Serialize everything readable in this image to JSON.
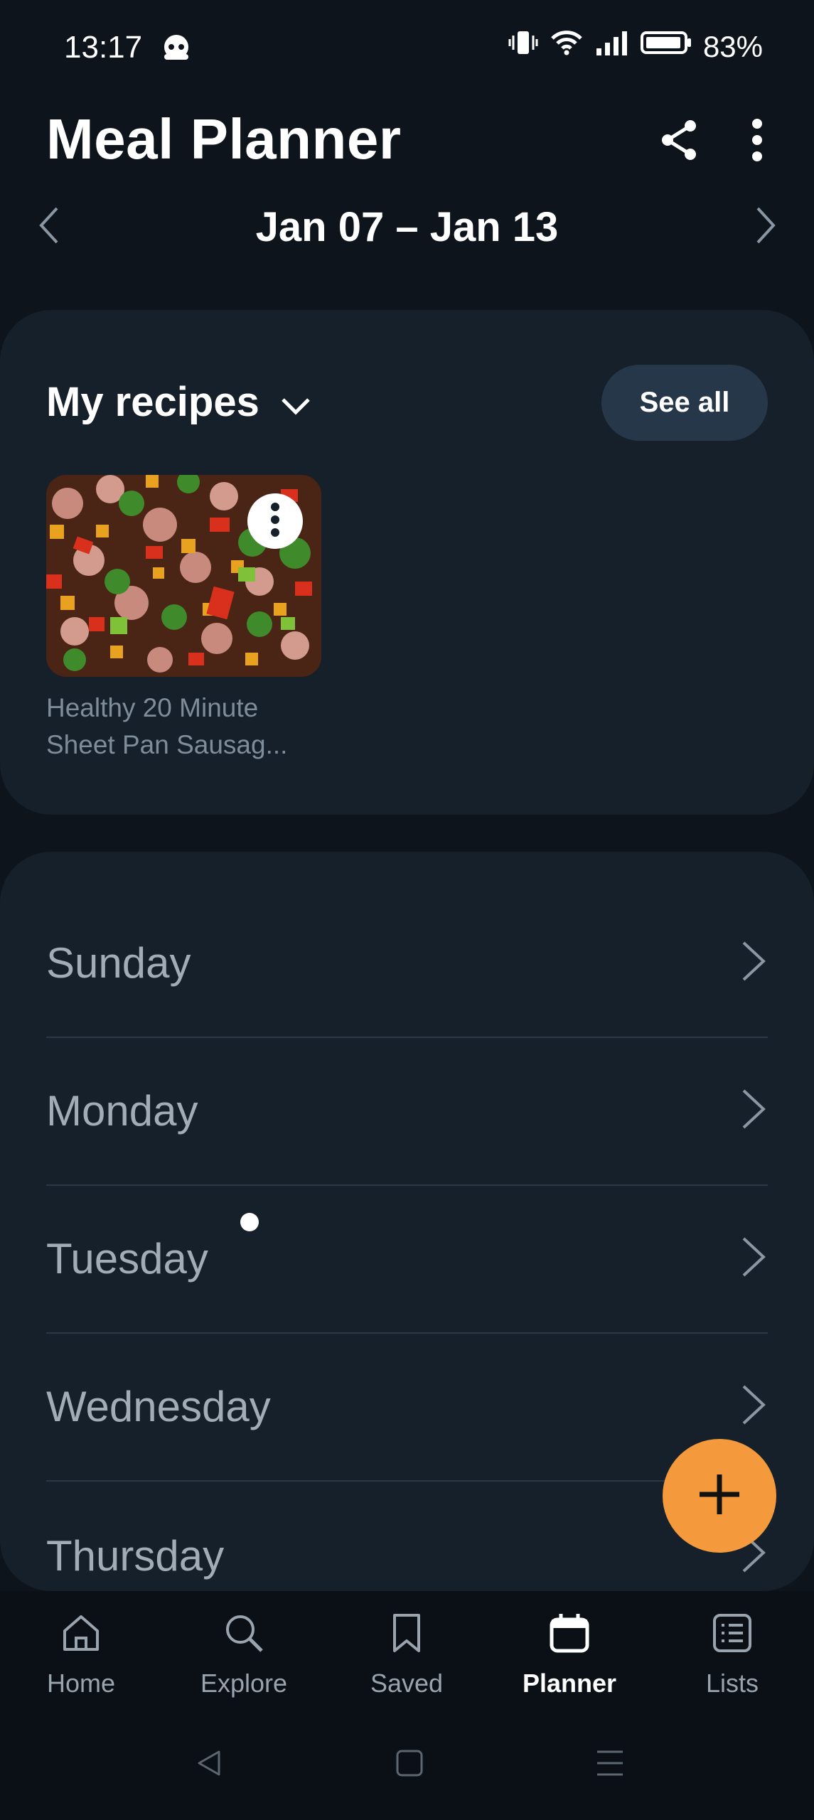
{
  "status_bar": {
    "time": "13:17",
    "battery": "83%",
    "icons": [
      "vibrate-icon",
      "wifi-icon",
      "signal-icon",
      "battery-icon"
    ]
  },
  "header": {
    "title": "Meal Planner",
    "week_range": "Jan 07 – Jan 13",
    "actions": [
      "share-icon",
      "more-vert-icon"
    ]
  },
  "recipes": {
    "title": "My recipes",
    "see_all_label": "See all",
    "items": [
      {
        "name": "Healthy 20 Minute Sheet Pan Sausag..."
      }
    ]
  },
  "days": [
    "Sunday",
    "Monday",
    "Tuesday",
    "Wednesday",
    "Thursday"
  ],
  "bottom_nav": {
    "items": [
      {
        "label": "Home",
        "icon": "home-icon"
      },
      {
        "label": "Explore",
        "icon": "search-icon"
      },
      {
        "label": "Saved",
        "icon": "bookmark-icon"
      },
      {
        "label": "Planner",
        "icon": "calendar-icon",
        "active": true
      },
      {
        "label": "Lists",
        "icon": "list-icon"
      }
    ]
  },
  "colors": {
    "background": "#0d141b",
    "card": "#16202a",
    "accent": "#f59a3c",
    "button": "#26374a"
  }
}
